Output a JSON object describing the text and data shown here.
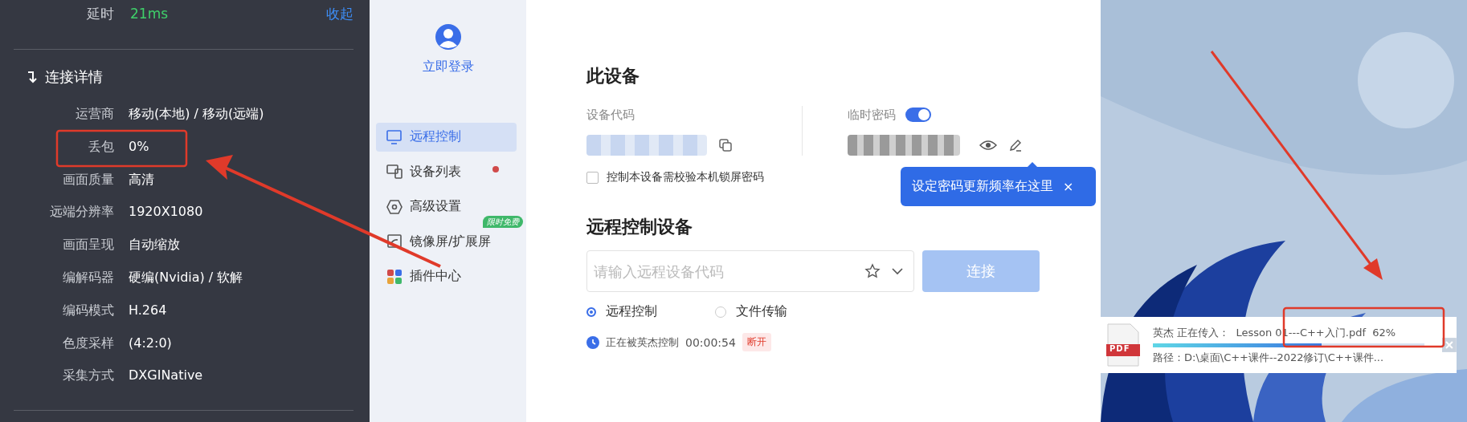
{
  "stats_panel": {
    "latency_label": "延时",
    "latency_value": "21ms",
    "collapse": "收起"
  },
  "details": {
    "title": "连接详情",
    "rows": [
      {
        "label": "运营商",
        "value": "移动(本地) / 移动(远端)"
      },
      {
        "label": "丢包",
        "value": "0%"
      },
      {
        "label": "画面质量",
        "value": "高清"
      },
      {
        "label": "远端分辨率",
        "value": "1920X1080"
      },
      {
        "label": "画面呈现",
        "value": "自动缩放"
      },
      {
        "label": "编解码器",
        "value": "硬编(Nvidia) / 软解"
      },
      {
        "label": "编码模式",
        "value": "H.264"
      },
      {
        "label": "色度采样",
        "value": "(4:2:0)"
      },
      {
        "label": "采集方式",
        "value": "DXGINative"
      }
    ]
  },
  "sidebar": {
    "login": "立即登录",
    "items": [
      {
        "label": "远程控制",
        "selected": true,
        "notification": false
      },
      {
        "label": "设备列表",
        "selected": false,
        "notification": true
      },
      {
        "label": "高级设置",
        "selected": false,
        "notification": false
      },
      {
        "label": "镜像屏/扩展屏",
        "selected": false,
        "notification": false,
        "tag": "限时免费"
      },
      {
        "label": "插件中心",
        "selected": false,
        "notification": false
      }
    ]
  },
  "this_device": {
    "title": "此设备",
    "code_label": "设备代码",
    "password_label": "临时密码",
    "password_on": true,
    "lock_option": {
      "label": "控制本设备需校验本机锁屏密码",
      "checked": false
    },
    "tooltip": {
      "text": "设定密码更新频率在这里",
      "close": "×"
    }
  },
  "remote": {
    "title": "远程控制设备",
    "placeholder": "请输入远程设备代码",
    "connect": {
      "label": "连接",
      "disabled": true
    },
    "modes": [
      {
        "label": "远程控制",
        "selected": true
      },
      {
        "label": "文件传输",
        "selected": false
      }
    ],
    "status": {
      "text": "正在被英杰控制",
      "time": "00:00:54",
      "action": "断开"
    }
  },
  "transfer": {
    "sender": "英杰 正在传入：",
    "file": "Lesson 01---C++入门.pdf",
    "percent": "62%",
    "level": 0.62,
    "path": "路径：D:\\桌面\\C++课件--2022修订\\C++课件...",
    "file_type": "PDF"
  }
}
